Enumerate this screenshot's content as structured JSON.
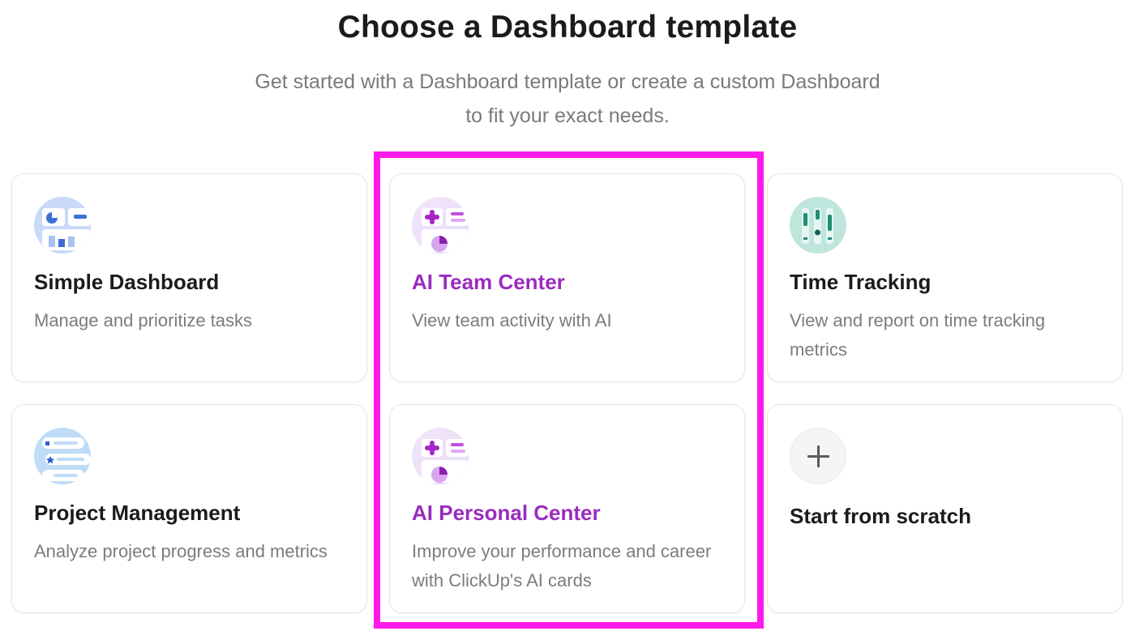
{
  "header": {
    "title": "Choose a Dashboard template",
    "subtitle_line1": "Get started with a Dashboard template or create a custom Dashboard",
    "subtitle_line2": "to fit your exact needs."
  },
  "templates": [
    {
      "name": "Simple Dashboard",
      "description": "Manage and prioritize tasks",
      "icon": "dashboard-grid-icon"
    },
    {
      "name": "AI Team Center",
      "description": "View team activity with AI",
      "icon": "ai-team-icon"
    },
    {
      "name": "Time Tracking",
      "description": "View and report on time tracking metrics",
      "icon": "time-tracking-icon"
    },
    {
      "name": "Project Management",
      "description": "Analyze project progress and metrics",
      "icon": "project-list-icon"
    },
    {
      "name": "AI Personal Center",
      "description": "Improve your performance and career with ClickUp's AI cards",
      "icon": "ai-personal-icon"
    },
    {
      "name": "Start from scratch",
      "icon": "plus-icon"
    }
  ],
  "colors": {
    "ai_accent": "#9b2bbf",
    "highlight_border": "#ff1aec",
    "text_primary": "#1b1b1b",
    "text_secondary": "#7c7c7c"
  }
}
